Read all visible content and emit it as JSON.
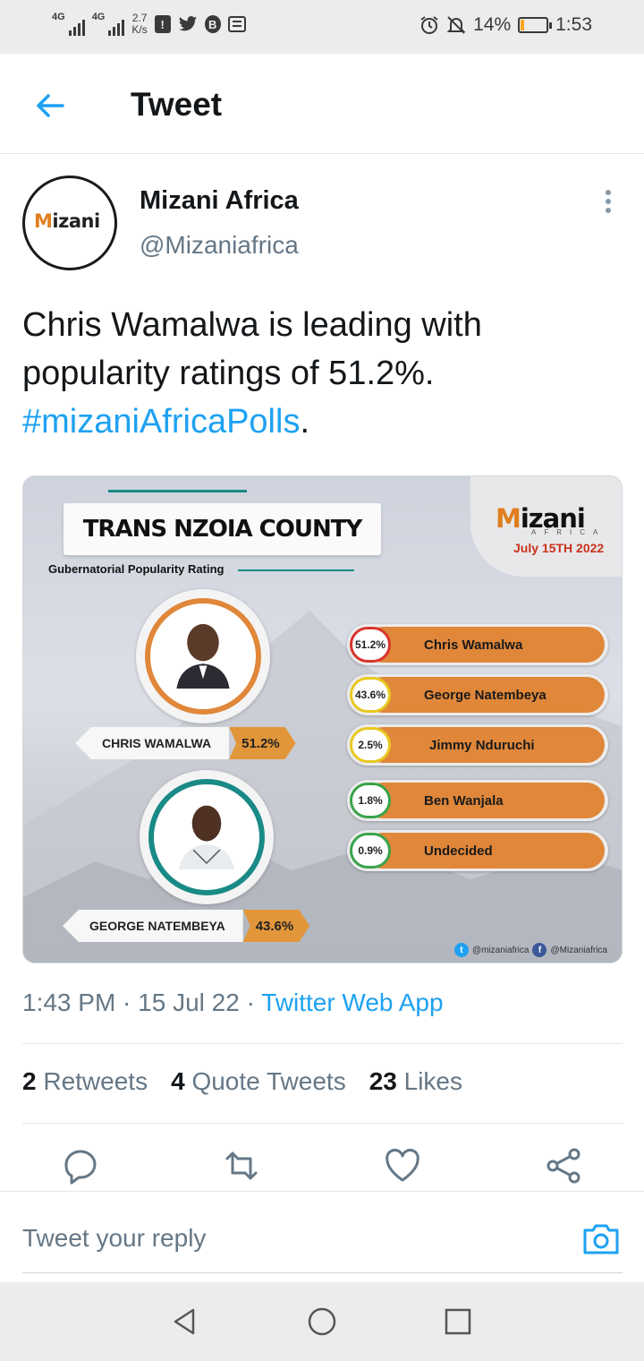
{
  "status_bar": {
    "network1": "4G",
    "network2": "4G",
    "speed_value": "2.7",
    "speed_unit": "K/s",
    "battery": "14%",
    "battery_level": 0.14,
    "time": "1:53"
  },
  "header": {
    "title": "Tweet"
  },
  "tweet": {
    "author_name": "Mizani Africa",
    "author_handle": "@Mizaniafrica",
    "avatar_logo": "izani",
    "avatar_logo_m": "M",
    "text_main": "Chris Wamalwa is leading with popularity ratings of 51.2%. ",
    "hashtag": "#mizaniAfricaPolls",
    "text_end": ".",
    "timestamp": "1:43 PM · 15 Jul 22 · ",
    "source": "Twitter Web App"
  },
  "poll_image": {
    "title": "TRANS NZOIA COUNTY",
    "subtitle": "Gubernatorial Popularity Rating",
    "logo_m": "M",
    "logo_rest": "izani",
    "logo_sub": "AFRICA",
    "date": "July 15TH 2022",
    "candidates_featured": [
      {
        "name": "CHRIS WAMALWA",
        "pct": "51.2%",
        "ring_color": "#e0873a"
      },
      {
        "name": "GEORGE NATEMBEYA",
        "pct": "43.6%",
        "ring_color": "#1a8a86"
      }
    ],
    "results": [
      {
        "pct": "51.2%",
        "name": "Chris Wamalwa",
        "badge_color": "#d9342b"
      },
      {
        "pct": "43.6%",
        "name": "George Natembeya",
        "badge_color": "#e8c81f"
      },
      {
        "pct": "2.5%",
        "name": "Jimmy Nduruchi",
        "badge_color": "#e8c81f"
      },
      {
        "pct": "1.8%",
        "name": "Ben Wanjala",
        "badge_color": "#3aa34a"
      },
      {
        "pct": "0.9%",
        "name": "Undecided",
        "badge_color": "#3aa34a"
      }
    ],
    "footer_twitter": "@mizaniafrica",
    "footer_facebook": "@Mizaniafrica"
  },
  "stats": {
    "retweets_count": "2",
    "retweets_label": "Retweets",
    "quotes_count": "4",
    "quotes_label": "Quote Tweets",
    "likes_count": "23",
    "likes_label": "Likes"
  },
  "reply": {
    "placeholder": "Tweet your reply"
  },
  "colors": {
    "accent": "#1da1f2",
    "brand_orange": "#e0873a",
    "brand_teal": "#1a8a86"
  }
}
